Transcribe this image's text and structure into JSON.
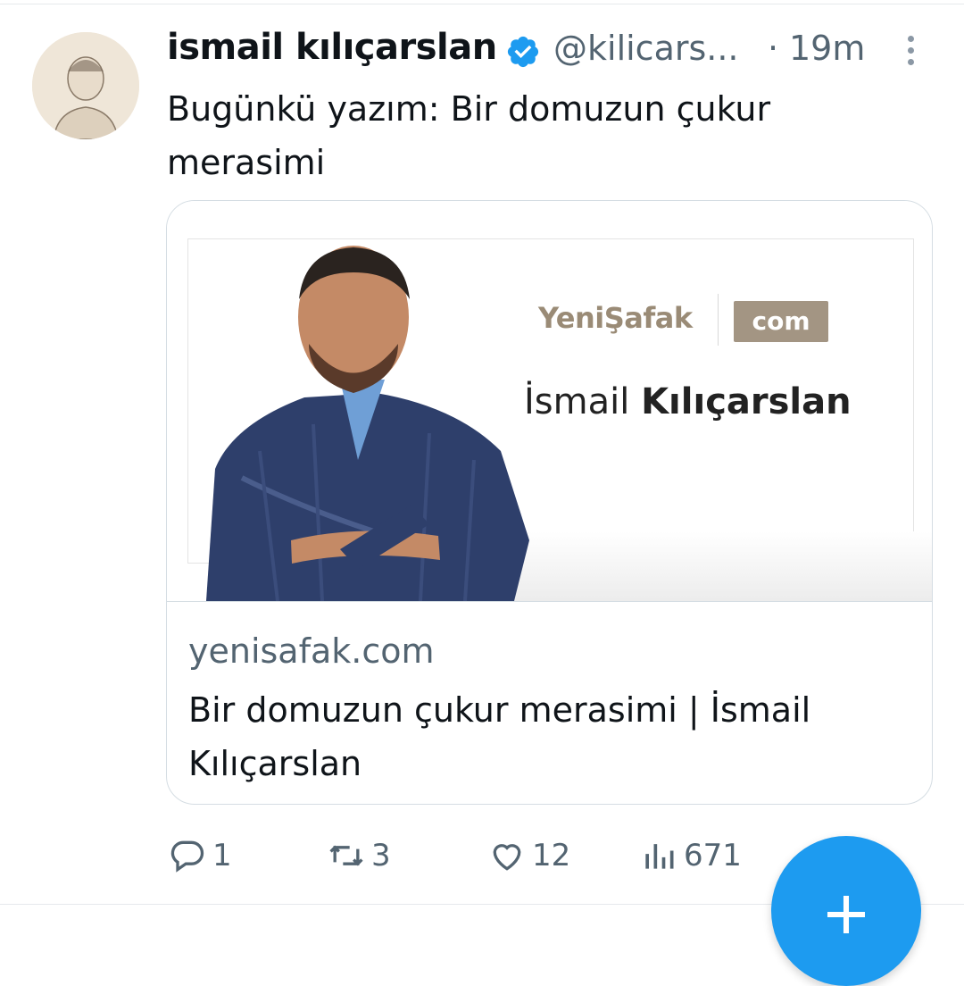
{
  "tweet": {
    "author_name": "ismail kılıçarslan",
    "handle": "@kilicars...",
    "separator": "·",
    "time": "19m",
    "text": "Bugünkü yazım: Bir domuzun çukur\nmerasimi"
  },
  "card": {
    "brand_name": "YeniŞafak",
    "brand_badge": "com",
    "author_first": "İsmail",
    "author_last": "Kılıçarslan",
    "domain": "yenisafak.com",
    "title": "Bir domuzun çukur merasimi | İsmail Kılıçarslan"
  },
  "actions": {
    "replies": "1",
    "retweets": "3",
    "likes": "12",
    "views": "671"
  },
  "icons": {
    "verified": "verified-badge-icon",
    "more": "more-vertical-icon",
    "reply": "reply-icon",
    "retweet": "retweet-icon",
    "like": "heart-icon",
    "views": "views-chart-icon",
    "compose": "plus-icon"
  },
  "colors": {
    "accent": "#1d9bf0",
    "secondary_text": "#536471",
    "brand": "#9a8b76"
  }
}
